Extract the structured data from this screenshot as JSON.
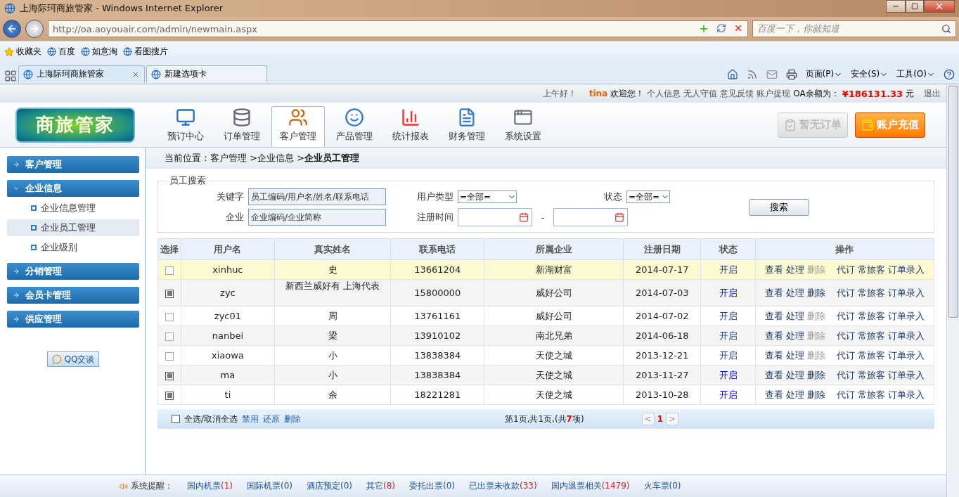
{
  "browser": {
    "title": "上海际珂商旅管家 - Windows Internet Explorer",
    "address": "http://oa.aoyouair.com/admin/newmain.aspx",
    "search_placeholder": "百度一下，你就知道",
    "favorites": [
      "收藏夹",
      "百度",
      "如意淘",
      "看图搜片"
    ],
    "tabs": [
      {
        "label": "上海际珂商旅管家",
        "selected": true
      },
      {
        "label": "新建选项卡",
        "selected": false
      }
    ],
    "commands": [
      "页面(P)",
      "安全(S)",
      "工具(O)"
    ]
  },
  "top_bar": {
    "greeting": "上午好！",
    "user": "tina",
    "welcome": "欢迎您！",
    "links": [
      "个人信息",
      "无人守值",
      "意见反馈",
      "账户提现"
    ],
    "balance_label": "OA余额为：",
    "balance": "¥186131.33",
    "currency": "元",
    "logout": "退出"
  },
  "header": {
    "logo": "商旅管家",
    "nav": [
      {
        "label": "预订中心",
        "kind": "monitor",
        "selected": false
      },
      {
        "label": "订单管理",
        "kind": "database",
        "selected": false
      },
      {
        "label": "客户管理",
        "kind": "users",
        "selected": true
      },
      {
        "label": "产品管理",
        "kind": "face",
        "selected": false
      },
      {
        "label": "统计报表",
        "kind": "bars",
        "selected": false
      },
      {
        "label": "财务管理",
        "kind": "document",
        "selected": false
      },
      {
        "label": "系统设置",
        "kind": "window",
        "selected": false
      }
    ],
    "buttons": [
      {
        "label": "暂无订单",
        "disabled": true
      },
      {
        "label": "账户充值",
        "disabled": false
      }
    ]
  },
  "sidebar": {
    "groups": [
      {
        "label": "客户管理",
        "expanded": false
      },
      {
        "label": "企业信息",
        "expanded": true,
        "children": [
          {
            "label": "企业信息管理",
            "selected": false
          },
          {
            "label": "企业员工管理",
            "selected": true
          },
          {
            "label": "企业级别",
            "selected": false
          }
        ]
      },
      {
        "label": "分销管理",
        "expanded": false
      },
      {
        "label": "会员卡管理",
        "expanded": false
      },
      {
        "label": "供应管理",
        "expanded": false
      }
    ],
    "chat_button": "QQ交谈"
  },
  "breadcrumb": "当前位置：客户管理 >企业信息 >**企业员工管理**",
  "search": {
    "legend": "员工搜索",
    "keyword_label": "关键字",
    "keyword_placeholder": "员工编码/用户名/姓名/联系电话",
    "company_label": "企业",
    "company_placeholder": "企业编码/企业简称",
    "user_type_label": "用户类型",
    "user_type": "=全部=",
    "status_label": "状态",
    "status": "=全部=",
    "date_label": "注册时间",
    "date_separator": "-",
    "button": "搜索"
  },
  "table": {
    "columns": [
      "选择",
      "用户名",
      "真实姓名",
      "联系电话",
      "所属企业",
      "注册日期",
      "状态",
      "操作"
    ],
    "rows": [
      {
        "checkbox_enabled": false,
        "highlighted": true,
        "username": "xinhuc",
        "real_name": "史",
        "phone": "13661204",
        "company": "新湖财富",
        "date": "2014-07-17",
        "status": "开启",
        "status_bright": false,
        "action_groups": [
          [
            {
              "label": "查看",
              "disabled": false
            },
            {
              "label": "处理",
              "disabled": false
            },
            {
              "label": "删除",
              "disabled": true
            }
          ],
          [
            {
              "label": "代订",
              "disabled": false
            },
            {
              "label": "常旅客",
              "disabled": false
            },
            {
              "label": "订单录入",
              "disabled": false
            }
          ]
        ]
      },
      {
        "checkbox_enabled": true,
        "highlighted": false,
        "username": "zyc",
        "real_name": "新西兰威好有 上海代表",
        "phone": "15800000",
        "company": "威好公司",
        "date": "2014-07-03",
        "status": "开启",
        "status_bright": true,
        "action_groups": [
          [
            {
              "label": "查看",
              "disabled": false
            },
            {
              "label": "处理",
              "disabled": false
            },
            {
              "label": "删除",
              "disabled": false
            }
          ],
          [
            {
              "label": "代订",
              "disabled": false
            },
            {
              "label": "常旅客",
              "disabled": false
            },
            {
              "label": "订单录入",
              "disabled": false
            }
          ]
        ]
      },
      {
        "checkbox_enabled": false,
        "highlighted": false,
        "username": "zyc01",
        "real_name": "周",
        "phone": "13761161",
        "company": "威好公司",
        "date": "2014-07-02",
        "status": "开启",
        "status_bright": false,
        "action_groups": [
          [
            {
              "label": "查看",
              "disabled": false
            },
            {
              "label": "处理",
              "disabled": false
            },
            {
              "label": "删除",
              "disabled": true
            }
          ],
          [
            {
              "label": "代订",
              "disabled": false
            },
            {
              "label": "常旅客",
              "disabled": false
            },
            {
              "label": "订单录入",
              "disabled": false
            }
          ]
        ]
      },
      {
        "checkbox_enabled": false,
        "highlighted": false,
        "username": "nanbei",
        "real_name": "梁",
        "phone": "13910102",
        "company": "南北兄弟",
        "date": "2014-06-18",
        "status": "开启",
        "status_bright": false,
        "action_groups": [
          [
            {
              "label": "查看",
              "disabled": false
            },
            {
              "label": "处理",
              "disabled": false
            },
            {
              "label": "删除",
              "disabled": true
            }
          ],
          [
            {
              "label": "代订",
              "disabled": false
            },
            {
              "label": "常旅客",
              "disabled": false
            },
            {
              "label": "订单录入",
              "disabled": false
            }
          ]
        ]
      },
      {
        "checkbox_enabled": false,
        "highlighted": false,
        "username": "xiaowa",
        "real_name": "小",
        "phone": "13838384",
        "company": "天使之城",
        "date": "2013-12-21",
        "status": "开启",
        "status_bright": false,
        "action_groups": [
          [
            {
              "label": "查看",
              "disabled": false
            },
            {
              "label": "处理",
              "disabled": false
            },
            {
              "label": "删除",
              "disabled": true
            }
          ],
          [
            {
              "label": "代订",
              "disabled": false
            },
            {
              "label": "常旅客",
              "disabled": false
            },
            {
              "label": "订单录入",
              "disabled": false
            }
          ]
        ]
      },
      {
        "checkbox_enabled": true,
        "highlighted": false,
        "username": "ma",
        "real_name": "小",
        "phone": "13838384",
        "company": "天使之城",
        "date": "2013-11-27",
        "status": "开启",
        "status_bright": true,
        "action_groups": [
          [
            {
              "label": "查看",
              "disabled": false
            },
            {
              "label": "处理",
              "disabled": false
            },
            {
              "label": "删除",
              "disabled": false
            }
          ],
          [
            {
              "label": "代订",
              "disabled": false
            },
            {
              "label": "常旅客",
              "disabled": false
            },
            {
              "label": "订单录入",
              "disabled": false
            }
          ]
        ]
      },
      {
        "checkbox_enabled": true,
        "highlighted": false,
        "username": "ti",
        "real_name": "余",
        "phone": "18221281",
        "company": "天使之城",
        "date": "2013-10-28",
        "status": "开启",
        "status_bright": true,
        "action_groups": [
          [
            {
              "label": "查看",
              "disabled": false
            },
            {
              "label": "处理",
              "disabled": false
            },
            {
              "label": "删除",
              "disabled": false
            }
          ],
          [
            {
              "label": "代订",
              "disabled": false
            },
            {
              "label": "常旅客",
              "disabled": false
            },
            {
              "label": "订单录入",
              "disabled": false
            }
          ]
        ]
      }
    ]
  },
  "table_footer": {
    "select_all_checked": false,
    "select_all": "全选/取消全选",
    "actions": [
      "禁用",
      "还原",
      "删除"
    ],
    "page_info_before": "第1页,共1页,(共",
    "total": "7",
    "page_info_after": "项)",
    "prev": "<",
    "page": "1",
    "next": ">"
  },
  "reminders": {
    "label": "系统提醒：",
    "items": [
      {
        "label": "国内机票",
        "count": "(1)",
        "alert": true
      },
      {
        "label": "国际机票",
        "count": "(0)",
        "alert": false
      },
      {
        "label": "酒店预定",
        "count": "(0)",
        "alert": false
      },
      {
        "label": "其它",
        "count": "(8)",
        "alert": true
      },
      {
        "label": "委托出票",
        "count": "(0)",
        "alert": false
      },
      {
        "label": "已出票未收款",
        "count": "(33)",
        "alert": true
      },
      {
        "label": "国内退票相关",
        "count": "(1479)",
        "alert": true
      },
      {
        "label": "火车票",
        "count": "(0)",
        "alert": false
      }
    ]
  }
}
